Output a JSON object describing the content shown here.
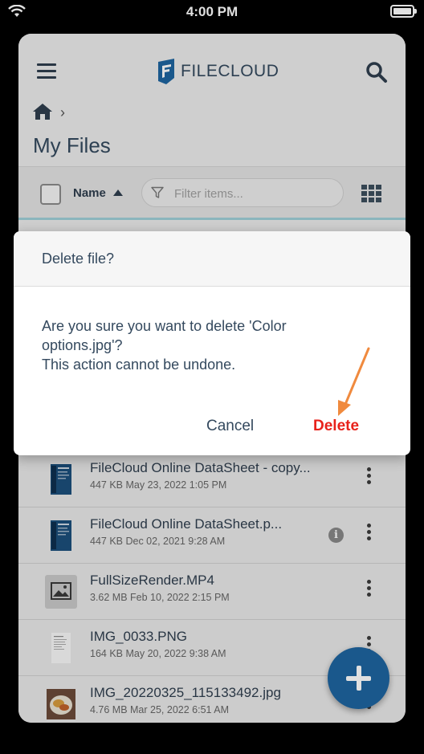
{
  "status_bar": {
    "time": "4:00 PM"
  },
  "header": {
    "logo_text": "FILECLOUD",
    "page_title": "My Files"
  },
  "toolbar": {
    "sort_label": "Name",
    "filter_placeholder": "Filter items..."
  },
  "dialog": {
    "title": "Delete file?",
    "message_line1": "Are you sure you want to delete 'Color",
    "message_line2": "options.jpg'?",
    "message_line3": "This action cannot be undone.",
    "cancel_label": "Cancel",
    "delete_label": "Delete"
  },
  "files": [
    {
      "name": "FileCloud Online DataSheet - copy...",
      "meta": "447 KB May 23, 2022 1:05 PM",
      "thumb": "doc"
    },
    {
      "name": "FileCloud Online DataSheet.p...",
      "meta": "447 KB Dec 02, 2021 9:28 AM",
      "thumb": "doc",
      "info": "i"
    },
    {
      "name": "FullSizeRender.MP4",
      "meta": "3.62 MB Feb 10, 2022 2:15 PM",
      "thumb": "image"
    },
    {
      "name": "IMG_0033.PNG",
      "meta": "164 KB May 20, 2022 9:38 AM",
      "thumb": "page"
    },
    {
      "name": "IMG_20220325_115133492.jpg",
      "meta": "4.76 MB Mar 25, 2022 6:51 AM",
      "thumb": "photo"
    }
  ],
  "colors": {
    "accent": "#1e65a0",
    "danger": "#e8221b",
    "text": "#34495e",
    "annotation_arrow": "#f08a3e"
  }
}
